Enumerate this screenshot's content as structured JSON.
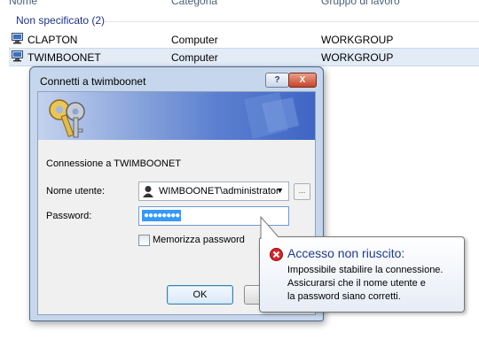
{
  "explorer": {
    "columns": {
      "name": "Nome",
      "category": "Categoria",
      "workgroup": "Gruppo di lavoro"
    },
    "group_label": "Non specificato (2)",
    "rows": [
      {
        "name": "CLAPTON",
        "category": "Computer",
        "workgroup": "WORKGROUP"
      },
      {
        "name": "TWIMBOONET",
        "category": "Computer",
        "workgroup": "WORKGROUP"
      }
    ]
  },
  "dialog": {
    "title": "Connetti a twimboonet",
    "help_label": "?",
    "close_label": "X",
    "connecting_text": "Connessione a TWIMBOONET",
    "username_label": "Nome utente:",
    "username_value": "WIMBOONET\\administrator",
    "password_label": "Password:",
    "password_value": "●●●●●●●●",
    "remember_label": "Memorizza password",
    "ok_label": "OK",
    "browse_label": "..."
  },
  "balloon": {
    "title": "Accesso non riuscito:",
    "message_lines": [
      "Impossibile stabilire la connessione.",
      "Assicurarsi che il nome utente e",
      "la password siano corretti."
    ]
  },
  "colors": {
    "accent": "#3399ff",
    "error": "#d8252a",
    "group_header": "#1e3287"
  }
}
